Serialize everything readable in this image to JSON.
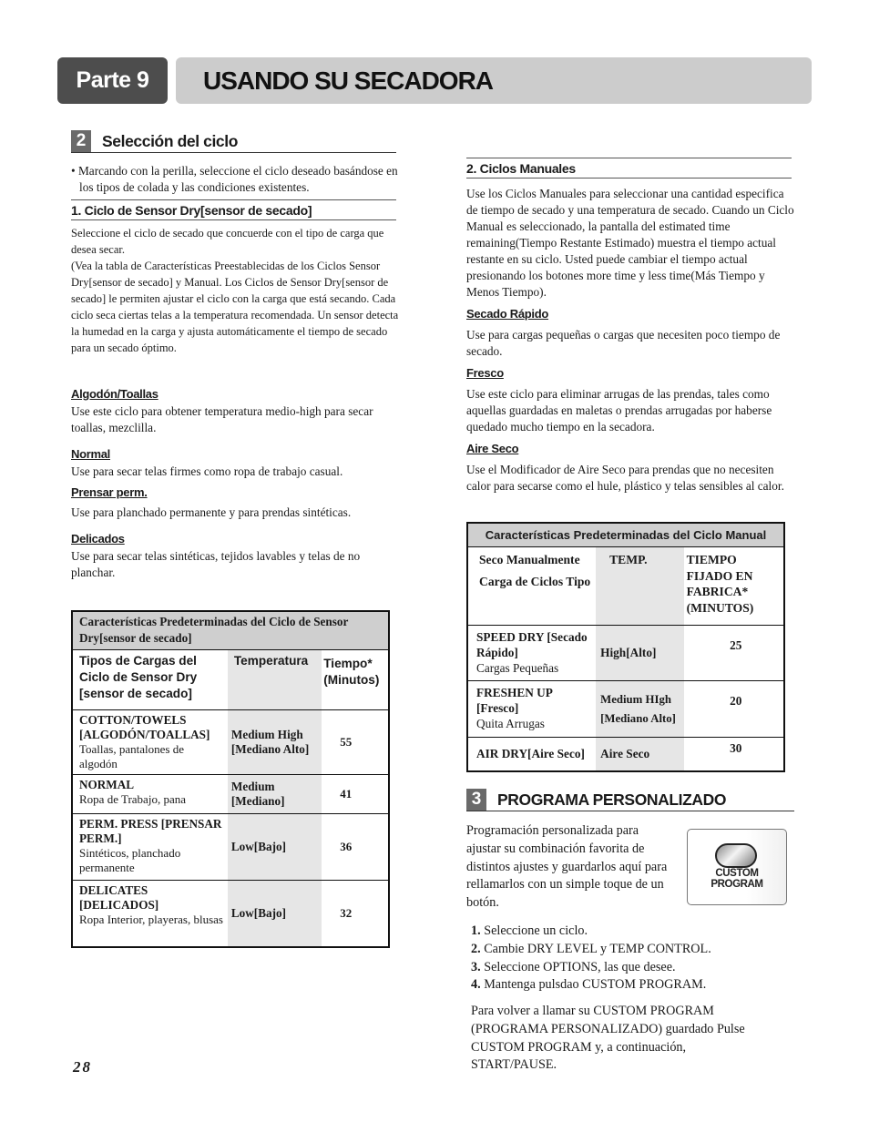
{
  "header": {
    "part_label": "Parte 9",
    "title": "USANDO SU SECADORA"
  },
  "section2": {
    "number": "2",
    "title": "Selección del ciclo",
    "intro": "• Marcando con la perilla, seleccione el ciclo deseado basándose en los tipos de colada y las condiciones existentes.",
    "sensor": {
      "heading": "1. Ciclo de Sensor Dry[sensor de secado]",
      "body": "Seleccione el ciclo de secado que concuerde con el tipo de carga que desea secar. (Vea la tabla de Características Preestablecidas de los Ciclos Sensor Dry[sensor de secado] y Manual. Los Ciclos de Sensor Dry[sensor de secado] le permiten ajustar el ciclo con la carga que está secando. Cada ciclo seca ciertas telas a la temperatura recomendada. Un sensor detecta la humedad en la carga y ajusta automáticamente el tiempo de secado para un secado óptimo.",
      "body_line1": "Seleccione el ciclo de secado que concuerde con el tipo de carga que desea secar.",
      "body_line2": "(Vea la tabla de Características Preestablecidas de los Ciclos Sensor Dry[sensor de secado] y Manual. Los Ciclos de Sensor Dry[sensor de secado] le permiten ajustar el ciclo con la carga que está secando. Cada ciclo seca ciertas telas a la temperatura recomendada. Un sensor detecta la humedad en la carga y ajusta automáticamente el tiempo de secado para un secado óptimo.",
      "cycles": [
        {
          "name": "Algodón/Toallas",
          "desc": "Use este ciclo para obtener temperatura medio-high para secar toallas, mezclilla."
        },
        {
          "name": "Normal",
          "desc": "Use para secar telas firmes como ropa de trabajo casual."
        },
        {
          "name": "Prensar perm.",
          "desc": "Use para planchado permanente y para prendas sintéticas."
        },
        {
          "name": "Delicados",
          "desc": "Use para secar telas sintéticas, tejidos lavables y telas de no planchar."
        }
      ],
      "table": {
        "caption": "Características Predeterminadas del Ciclo de Sensor Dry[sensor de secado]",
        "headers": [
          "Tipos de Cargas del Ciclo de Sensor Dry [sensor de secado]",
          "Temperatura",
          "Tiempo* (Minutos)"
        ],
        "rows": [
          {
            "cycle": "COTTON/TOWELS [ALGODÓN/TOALLAS]",
            "load": "Toallas, pantalones de algodón",
            "temp": "Medium High [Mediano Alto]",
            "time": "55"
          },
          {
            "cycle": "NORMAL",
            "load": "Ropa de Trabajo, pana",
            "temp": "Medium [Mediano]",
            "time": "41"
          },
          {
            "cycle": "PERM. PRESS [PRENSAR PERM.]",
            "load": "Sintéticos, planchado permanente",
            "temp": "Low[Bajo]",
            "time": "36"
          },
          {
            "cycle": "DELICATES [DELICADOS]",
            "load": "Ropa Interior, playeras, blusas",
            "temp": "Low[Bajo]",
            "time": "32"
          }
        ]
      }
    },
    "manual": {
      "heading": "2. Ciclos Manuales",
      "body": "Use los Ciclos Manuales para seleccionar una cantidad especifica de tiempo de secado y una temperatura de secado. Cuando un Ciclo Manual es seleccionado, la pantalla del estimated time remaining(Tiempo Restante Estimado) muestra el tiempo actual restante en su ciclo. Usted puede cambiar el tiempo actual presionando los botones more time y less time(Más Tiempo y Menos Tiempo).",
      "cycles": [
        {
          "name": "Secado Rápido",
          "desc": "Use para cargas pequeñas o cargas que necesiten poco tiempo de secado."
        },
        {
          "name": "Fresco",
          "desc": "Use este ciclo para eliminar arrugas de las prendas, tales como aquellas guardadas en maletas o prendas arrugadas por haberse quedado mucho tiempo en la secadora."
        },
        {
          "name": "Aire Seco",
          "desc": "Use el Modificador de Aire Seco para prendas que no necesiten calor para secarse como el hule, plástico y telas sensibles al calor."
        }
      ],
      "table": {
        "caption": "Características Predeterminadas del Ciclo Manual",
        "headers": {
          "col1_line1": "Seco Manualmente",
          "col1_line2": "Carga de Ciclos Tipo",
          "col2": "TEMP.",
          "col3": "TIEMPO FIJADO EN FABRICA* (MINUTOS)"
        },
        "rows": [
          {
            "cycle": "SPEED DRY [Secado Rápido]",
            "load": "Cargas Pequeñas",
            "temp": "High[Alto]",
            "time": "25"
          },
          {
            "cycle": "FRESHEN UP [Fresco]",
            "load": "Quita Arrugas",
            "temp": "Medium HIgh [Mediano Alto]",
            "time": "20"
          },
          {
            "cycle": "AIR DRY[Aire Seco]",
            "load": "",
            "temp": "Aire Seco",
            "time": "30"
          }
        ]
      }
    }
  },
  "section3": {
    "number": "3",
    "title": "PROGRAMA PERSONALIZADO",
    "intro": "Programación personalizada para ajustar su combinación favorita de distintos ajustes y guardarlos aquí para rellamarlos con un simple toque de un botón.",
    "button_label_line1": "CUSTOM",
    "button_label_line2": "PROGRAM",
    "steps": [
      {
        "num": "1.",
        "text": "Seleccione un ciclo."
      },
      {
        "num": "2.",
        "text": "Cambie DRY LEVEL y TEMP CONTROL."
      },
      {
        "num": "3.",
        "text": "Seleccione OPTIONS, las que desee."
      },
      {
        "num": "4.",
        "text": "Mantenga pulsdao CUSTOM PROGRAM."
      }
    ],
    "recall": "Para volver a llamar su CUSTOM PROGRAM (PROGRAMA PERSONALIZADO) guardado Pulse CUSTOM PROGRAM y, a continuación, START/PAUSE."
  },
  "footer": {
    "page_number": "28"
  }
}
